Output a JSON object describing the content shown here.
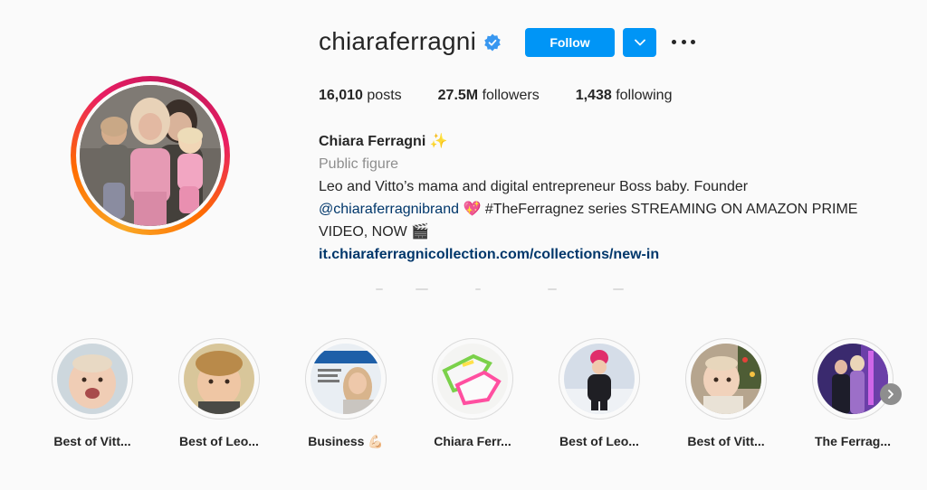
{
  "profile": {
    "username": "chiaraferragni",
    "follow_label": "Follow",
    "stats": {
      "posts_value": "16,010",
      "posts_label": "posts",
      "followers_value": "27.5M",
      "followers_label": "followers",
      "following_value": "1,438",
      "following_label": "following"
    },
    "bio": {
      "name": "Chiara Ferragni",
      "name_emoji": "✨",
      "category": "Public figure",
      "line1": "Leo and Vitto’s mama and digital entrepreneur Boss baby. Founder",
      "mention": "@chiaraferragnibrand",
      "heart_emoji": "💖",
      "line2_rest": "#TheFerragnez series STREAMING ON AMAZON PRIME",
      "line3": "VIDEO, NOW",
      "clapper_emoji": "🎬",
      "website": "it.chiaraferragnicollection.com/collections/new-in"
    }
  },
  "highlights": [
    {
      "label": "Best of Vitt...",
      "icon": "baby-girl-photo"
    },
    {
      "label": "Best of Leo...",
      "icon": "boy-photo"
    },
    {
      "label": "Business 💪🏻",
      "icon": "magazine-cover-photo"
    },
    {
      "label": "Chiara Ferr...",
      "icon": "sneakers-photo"
    },
    {
      "label": "Best of Leo...",
      "icon": "boy-snow-photo"
    },
    {
      "label": "Best of Vitt...",
      "icon": "baby-girl-photo-2"
    },
    {
      "label": "The Ferrag...",
      "icon": "event-photo"
    }
  ],
  "colors": {
    "accent": "#0095f6",
    "text": "#262626",
    "muted": "#8e8e8e",
    "link": "#00376b",
    "background": "#fafafa"
  }
}
